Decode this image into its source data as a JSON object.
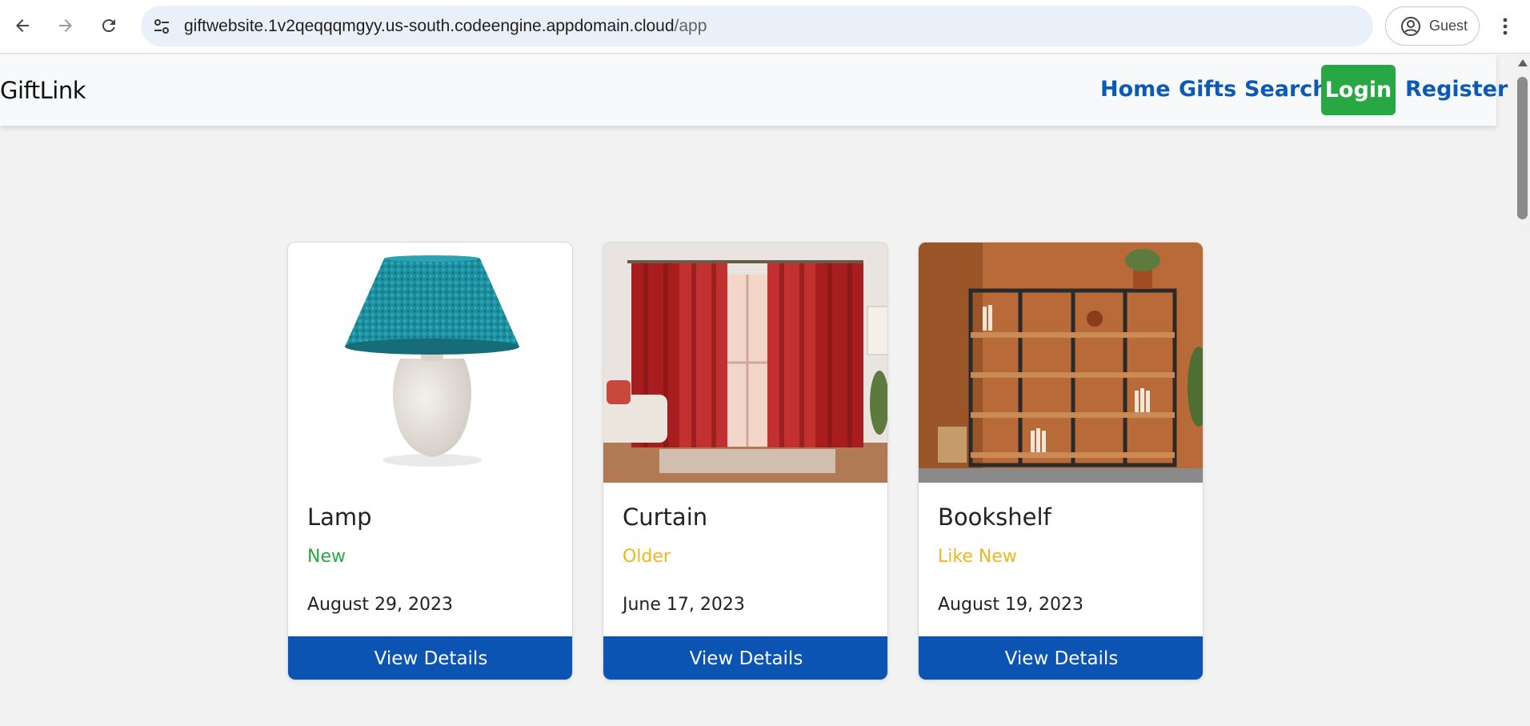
{
  "browser": {
    "url_host": "giftwebsite.1v2qeqqqmgyy.us-south.codeengine.appdomain.cloud",
    "url_path": "/app",
    "profile_label": "Guest"
  },
  "navbar": {
    "brand": "GiftLink",
    "links": [
      "Home",
      "Gifts",
      "Search"
    ],
    "login_label": "Login",
    "register_label": "Register"
  },
  "colors": {
    "link": "#0b5ab4",
    "login_bg": "#28a745",
    "button_bg": "#0b54b4",
    "condition_new": "#28a745",
    "condition_older": "#f0b61e",
    "condition_like_new": "#f0b61e"
  },
  "gifts": [
    {
      "name": "Lamp",
      "condition": "New",
      "date": "August 29, 2023",
      "button": "View Details",
      "image": "lamp-image"
    },
    {
      "name": "Curtain",
      "condition": "Older",
      "date": "June 17, 2023",
      "button": "View Details",
      "image": "curtain-image"
    },
    {
      "name": "Bookshelf",
      "condition": "Like New",
      "date": "August 19, 2023",
      "button": "View Details",
      "image": "bookshelf-image"
    }
  ]
}
